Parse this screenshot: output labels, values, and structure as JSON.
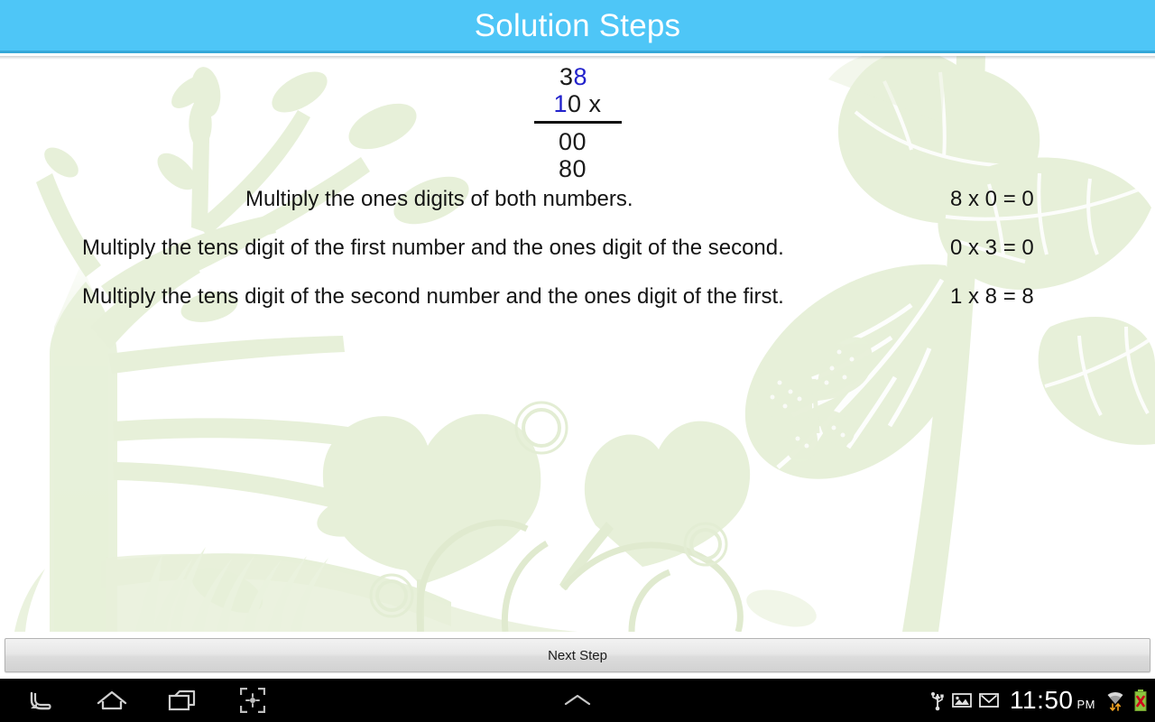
{
  "header": {
    "title": "Solution Steps",
    "bg_color": "#4EC6F7",
    "border_color": "#36A7D8",
    "text_color": "#ffffff"
  },
  "calculation": {
    "multiplicand_black": "3",
    "multiplicand_blue": "8",
    "multiplier_blue": "1",
    "multiplier_black": "0 x",
    "operator": "x",
    "partial_products": [
      "00",
      "80"
    ],
    "highlight_color": "#2222CC",
    "text_color": "#1b1b1b"
  },
  "steps": [
    {
      "text": "Multiply the ones digits of both numbers.",
      "result": "8 x 0 = 0"
    },
    {
      "text": "Multiply the tens digit of the first number and the ones digit of the second.",
      "result": "0 x 3 = 0"
    },
    {
      "text": "Multiply the tens digit of the second number and the ones digit of the first.",
      "result": "1 x 8 = 8"
    }
  ],
  "footer": {
    "next_step_label": "Next Step"
  },
  "navbar": {
    "back_icon": "back-arrow-icon",
    "home_icon": "home-icon",
    "recents_icon": "recent-apps-icon",
    "screenshot_icon": "screenshot-icon",
    "chevron_icon": "chevron-up-icon",
    "status_icons": [
      "usb-icon",
      "screenshot-notification-icon",
      "gmail-icon",
      "wifi-icon",
      "battery-error-icon"
    ],
    "clock_time": "11:50",
    "clock_ampm": "PM",
    "battery_color": "#8CC63F",
    "battery_error_color": "#D0021B"
  },
  "background": {
    "art_color": "#E6EFD8",
    "art_color_light": "#EFF5E6",
    "vein_color": "#FFFFFF",
    "description": "pale green botanical silhouette: tree, leaves, butterfly, vines, circles, grass"
  }
}
